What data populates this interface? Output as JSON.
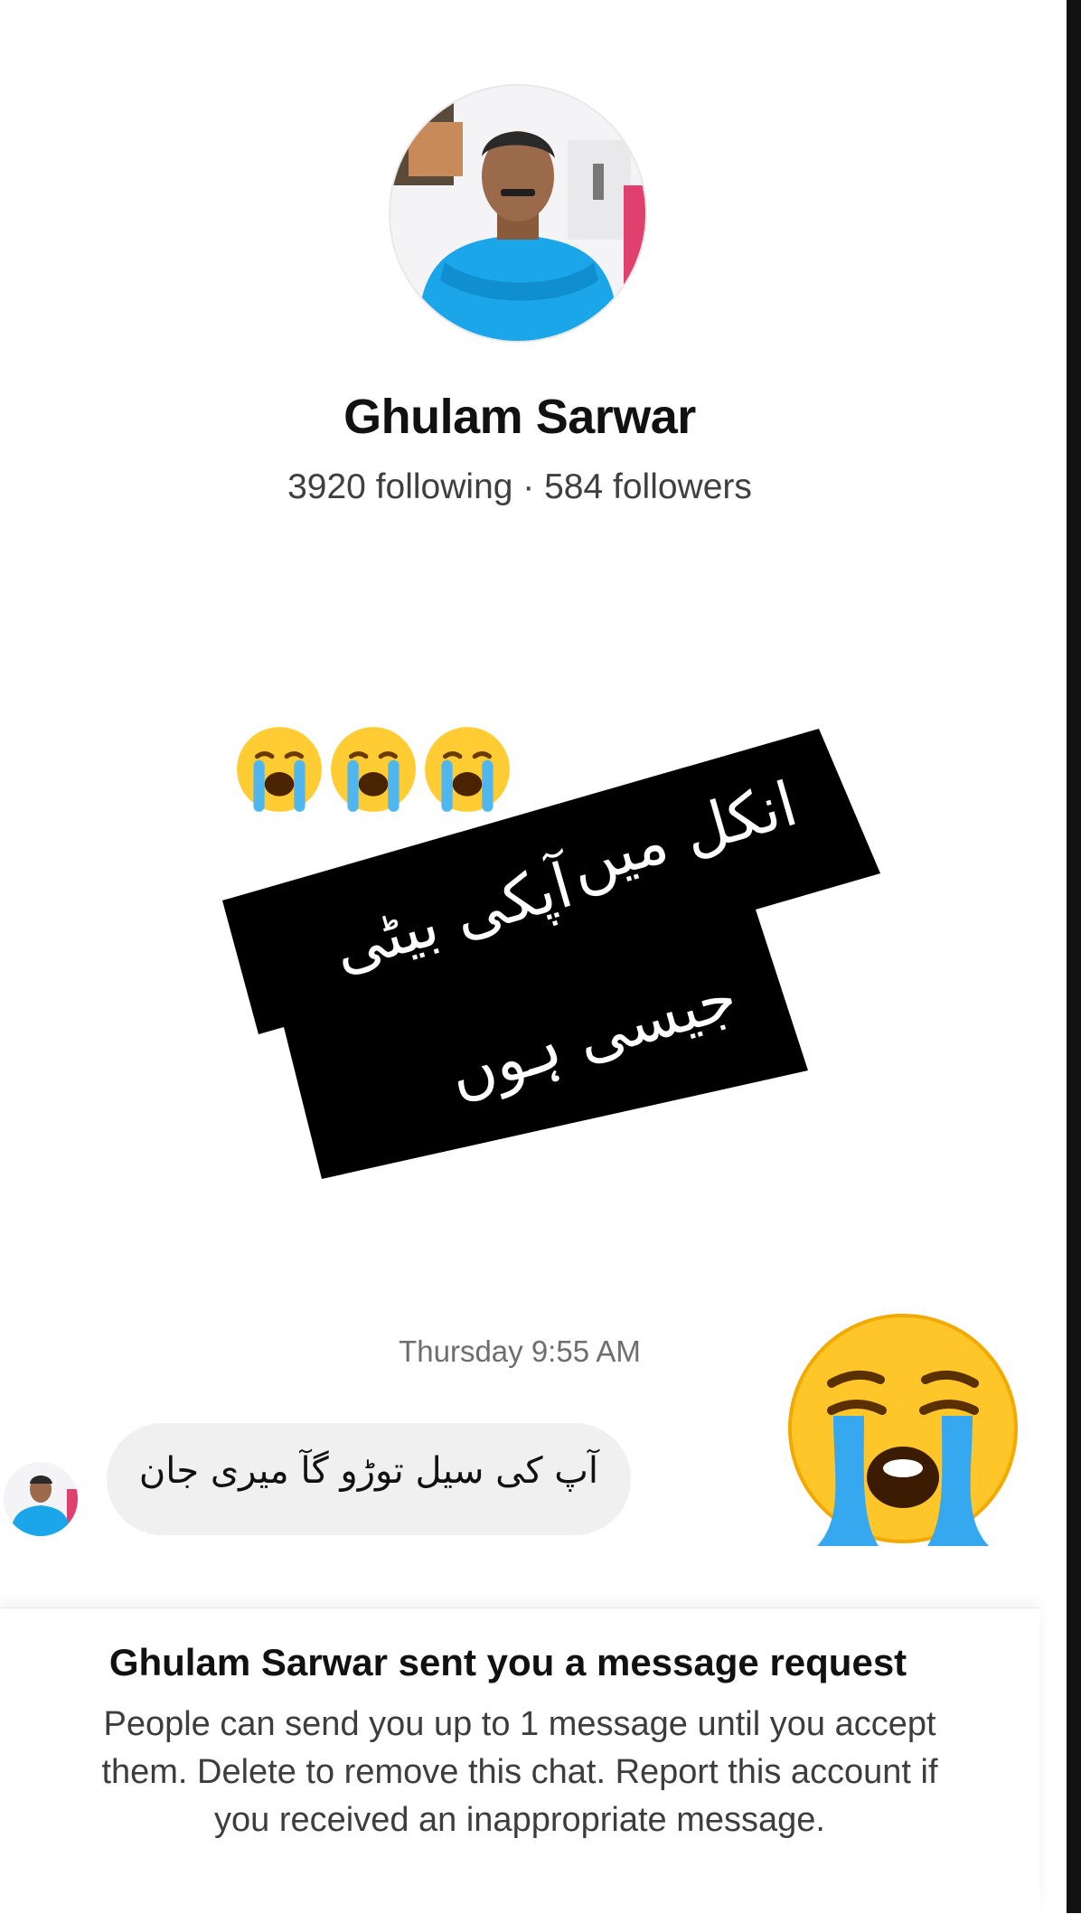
{
  "profile": {
    "name": "Ghulam Sarwar",
    "stats": "3920 following · 584 followers"
  },
  "overlay": {
    "emoji_row": [
      "loudly-crying-face",
      "loudly-crying-face",
      "loudly-crying-face"
    ],
    "sticker_lines": [
      "انکل میں",
      "آپکی بیٹی",
      "جیسی ہوں"
    ],
    "big_emoji": "loudly-crying-face"
  },
  "chat": {
    "timestamp": "Thursday 9:55 AM",
    "message": "آپ کی سیل توڑو گآ میری جان"
  },
  "request": {
    "title": "Ghulam Sarwar sent you a message request",
    "body": "People can send you up to 1 message until you accept them. Delete to remove this chat. Report this account if you received an inappropriate message."
  },
  "colors": {
    "background": "#ffffff",
    "sticker_bg": "#000000",
    "bubble_bg": "#f0f0f0",
    "shirt_blue": "#1aa6e8"
  }
}
